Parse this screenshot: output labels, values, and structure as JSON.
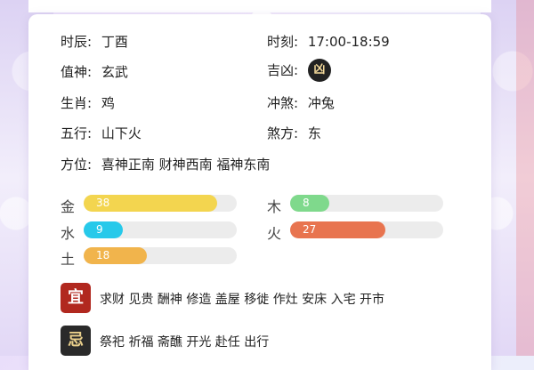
{
  "info": {
    "shichen": {
      "label": "时辰:",
      "value": "丁酉"
    },
    "shike": {
      "label": "时刻:",
      "value": "17:00-18:59"
    },
    "zhishen": {
      "label": "值神:",
      "value": "玄武"
    },
    "jixiong": {
      "label": "吉凶:",
      "value": "凶"
    },
    "shengxiao": {
      "label": "生肖:",
      "value": "鸡"
    },
    "chongsha": {
      "label": "冲煞:",
      "value": "冲兔"
    },
    "wuxing": {
      "label": "五行:",
      "value": "山下火"
    },
    "shafang": {
      "label": "煞方:",
      "value": "东"
    },
    "fangwei": {
      "label": "方位:",
      "value": "喜神正南 财神西南 福神东南"
    }
  },
  "elements": [
    {
      "name": "金",
      "value": 38,
      "color": "#f3d54f",
      "scale_max": 100
    },
    {
      "name": "木",
      "value": 8,
      "color": "#7fd98c",
      "scale_max": 100
    },
    {
      "name": "水",
      "value": 9,
      "color": "#27c9ea",
      "scale_max": 100
    },
    {
      "name": "火",
      "value": 27,
      "color": "#e8744f",
      "scale_max": 100
    },
    {
      "name": "土",
      "value": 18,
      "color": "#f1b44c",
      "scale_max": 100
    }
  ],
  "yi": {
    "tag": "宜",
    "items": "求财 见贵 酬神 修造 盖屋 移徙 作灶 安床 入宅 开市"
  },
  "ji": {
    "tag": "忌",
    "items": "祭祀 祈福 斋醮 开光 赴任 出行"
  }
}
